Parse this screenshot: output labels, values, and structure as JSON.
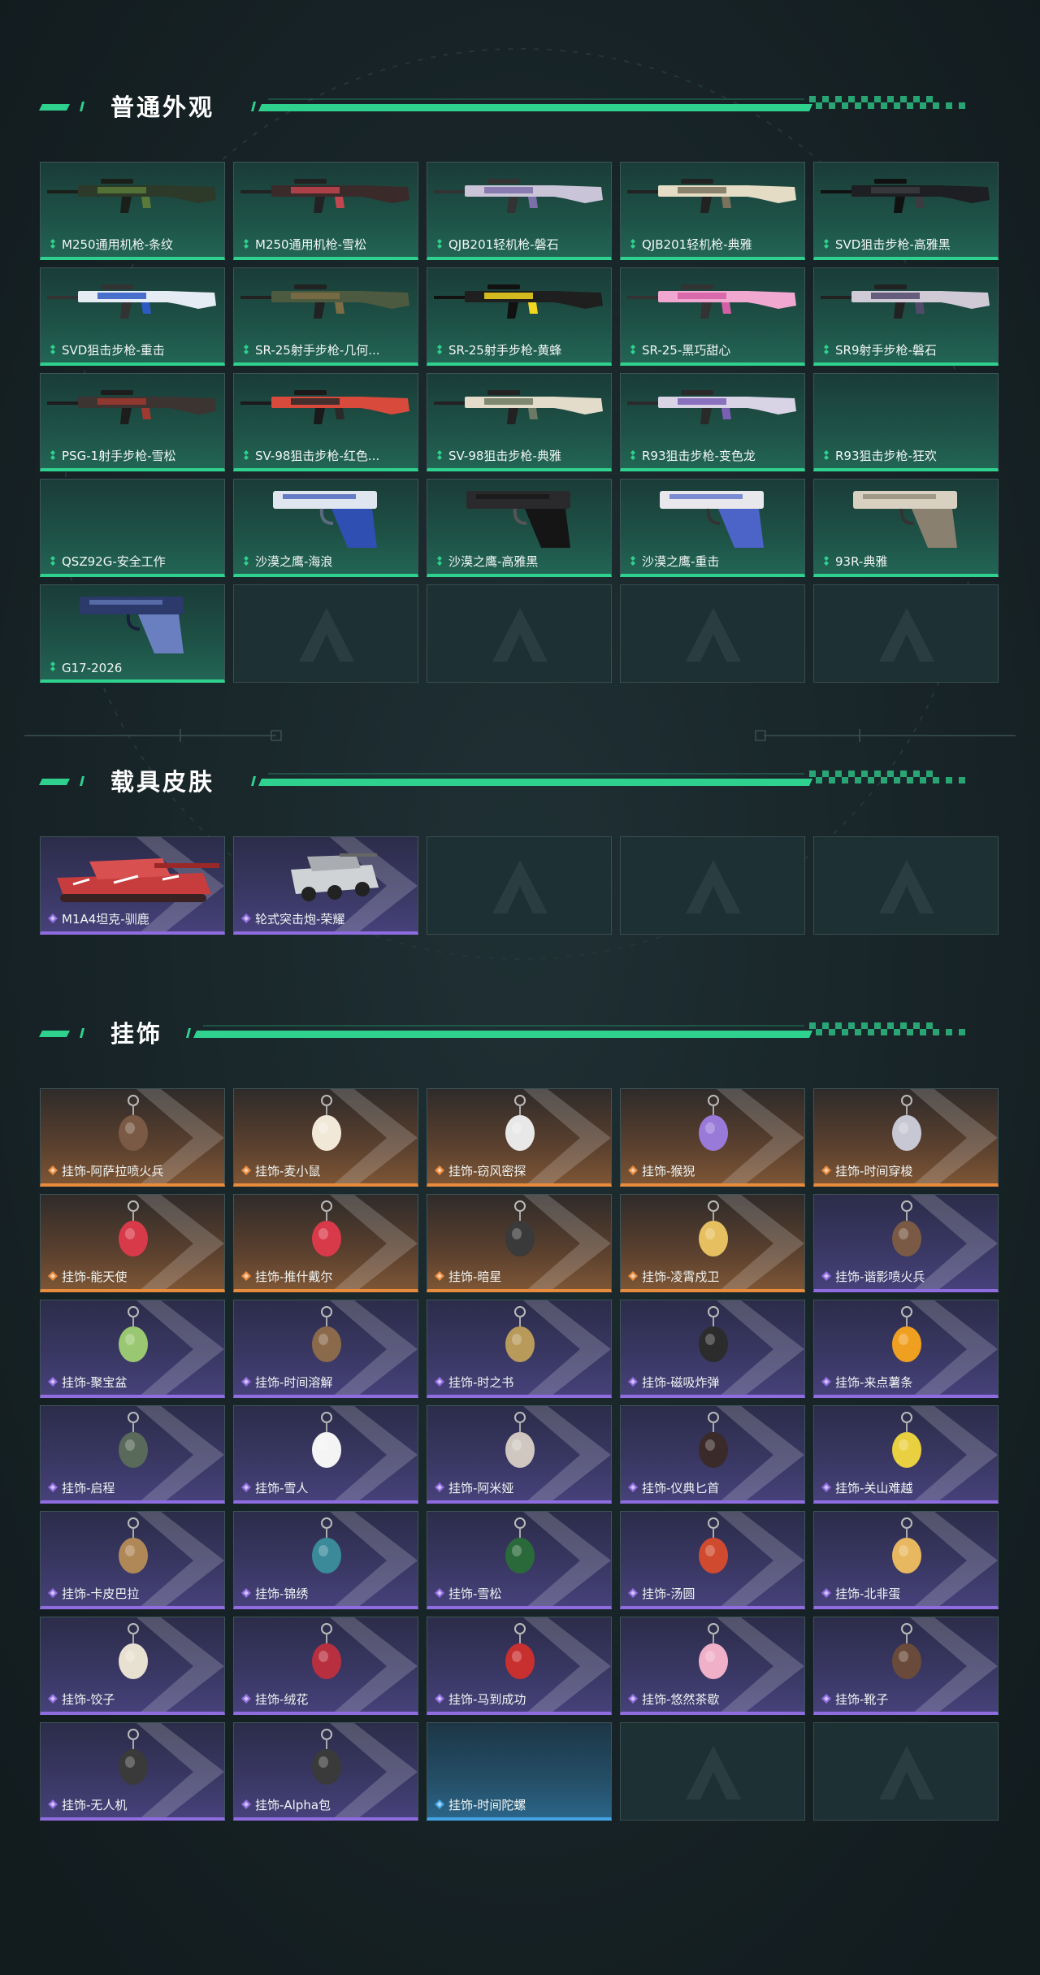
{
  "colors": {
    "green": "#2fd18e",
    "purple": "#8f6ce0",
    "orange": "#e98b3c",
    "blue": "#43a4e6"
  },
  "sections": {
    "weapons": {
      "title": "普通外观",
      "items": [
        {
          "label": "M250通用机枪-条纹",
          "rarity": "green",
          "art": "lmg"
        },
        {
          "label": "M250通用机枪-雪松",
          "rarity": "green",
          "art": "lmg-red"
        },
        {
          "label": "QJB201轻机枪-磐石",
          "rarity": "green",
          "art": "lmg-marble"
        },
        {
          "label": "QJB201轻机枪-典雅",
          "rarity": "green",
          "art": "lmg-cream"
        },
        {
          "label": "SVD狙击步枪-高雅黑",
          "rarity": "green",
          "art": "sniper-dark"
        },
        {
          "label": "SVD狙击步枪-重击",
          "rarity": "green",
          "art": "sniper-blue"
        },
        {
          "label": "SR-25射手步枪-几何...",
          "rarity": "green",
          "art": "rifle-camo"
        },
        {
          "label": "SR-25射手步枪-黄蜂",
          "rarity": "green",
          "art": "rifle-yellow"
        },
        {
          "label": "SR-25-黑巧甜心",
          "rarity": "green",
          "art": "rifle-pink"
        },
        {
          "label": "SR9射手步枪-磐石",
          "rarity": "green",
          "art": "rifle-marble"
        },
        {
          "label": "PSG-1射手步枪-雪松",
          "rarity": "green",
          "art": "psg"
        },
        {
          "label": "SV-98狙击步枪-红色...",
          "rarity": "green",
          "art": "sv98-red"
        },
        {
          "label": "SV-98狙击步枪-典雅",
          "rarity": "green",
          "art": "sv98-cream"
        },
        {
          "label": "R93狙击步枪-变色龙",
          "rarity": "green",
          "art": "r93"
        },
        {
          "label": "R93狙击步枪-狂欢",
          "rarity": "green",
          "art": "none"
        },
        {
          "label": "QSZ92G-安全工作",
          "rarity": "green",
          "art": "none"
        },
        {
          "label": "沙漠之鹰-海浪",
          "rarity": "green",
          "art": "pistol-blue"
        },
        {
          "label": "沙漠之鹰-高雅黑",
          "rarity": "green",
          "art": "pistol-black"
        },
        {
          "label": "沙漠之鹰-重击",
          "rarity": "green",
          "art": "pistol-white"
        },
        {
          "label": "93R-典雅",
          "rarity": "green",
          "art": "pistol-cream"
        },
        {
          "label": "G17-2026",
          "rarity": "green",
          "art": "pistol-navy"
        },
        {
          "label": "",
          "rarity": "empty"
        },
        {
          "label": "",
          "rarity": "empty"
        },
        {
          "label": "",
          "rarity": "empty"
        },
        {
          "label": "",
          "rarity": "empty"
        }
      ]
    },
    "vehicles": {
      "title": "载具皮肤",
      "items": [
        {
          "label": "M1A4坦克-驯鹿",
          "rarity": "purple",
          "art": "tank"
        },
        {
          "label": "轮式突击炮-荣耀",
          "rarity": "purple",
          "art": "car"
        },
        {
          "label": "",
          "rarity": "empty"
        },
        {
          "label": "",
          "rarity": "empty"
        },
        {
          "label": "",
          "rarity": "empty"
        }
      ]
    },
    "charms": {
      "title": "挂饰",
      "items": [
        {
          "label": "挂饰-阿萨拉喷火兵",
          "rarity": "orange",
          "art": "charm-figure"
        },
        {
          "label": "挂饰-麦小鼠",
          "rarity": "orange",
          "art": "charm-mouse"
        },
        {
          "label": "挂饰-窃风密探",
          "rarity": "orange",
          "art": "charm-spy"
        },
        {
          "label": "挂饰-猴猊",
          "rarity": "orange",
          "art": "charm-purple"
        },
        {
          "label": "挂饰-时间穿梭",
          "rarity": "orange",
          "art": "charm-ring"
        },
        {
          "label": "挂饰-能天使",
          "rarity": "orange",
          "art": "charm-tag"
        },
        {
          "label": "挂饰-推什戴尔",
          "rarity": "orange",
          "art": "charm-tag"
        },
        {
          "label": "挂饰-暗星",
          "rarity": "orange",
          "art": "charm-bird"
        },
        {
          "label": "挂饰-凌霄戍卫",
          "rarity": "orange",
          "art": "charm-eagle"
        },
        {
          "label": "挂饰-谐影喷火兵",
          "rarity": "purple",
          "art": "charm-figure"
        },
        {
          "label": "挂饰-聚宝盆",
          "rarity": "purple",
          "art": "charm-pot"
        },
        {
          "label": "挂饰-时间溶解",
          "rarity": "purple",
          "art": "charm-small"
        },
        {
          "label": "挂饰-时之书",
          "rarity": "purple",
          "art": "charm-book"
        },
        {
          "label": "挂饰-磁吸炸弹",
          "rarity": "purple",
          "art": "charm-bomb"
        },
        {
          "label": "挂饰-来点薯条",
          "rarity": "purple",
          "art": "charm-fries"
        },
        {
          "label": "挂饰-启程",
          "rarity": "purple",
          "art": "charm-disc"
        },
        {
          "label": "挂饰-雪人",
          "rarity": "purple",
          "art": "charm-snowman"
        },
        {
          "label": "挂饰-阿米娅",
          "rarity": "purple",
          "art": "charm-bunny"
        },
        {
          "label": "挂饰-仪典匕首",
          "rarity": "purple",
          "art": "charm-dagger"
        },
        {
          "label": "挂饰-关山难越",
          "rarity": "purple",
          "art": "charm-yellow"
        },
        {
          "label": "挂饰-卡皮巴拉",
          "rarity": "purple",
          "art": "charm-capy"
        },
        {
          "label": "挂饰-锦绣",
          "rarity": "purple",
          "art": "charm-butterfly"
        },
        {
          "label": "挂饰-雪松",
          "rarity": "purple",
          "art": "charm-tree"
        },
        {
          "label": "挂饰-汤圆",
          "rarity": "purple",
          "art": "charm-bowl"
        },
        {
          "label": "挂饰-北非蛋",
          "rarity": "purple",
          "art": "charm-pan"
        },
        {
          "label": "挂饰-饺子",
          "rarity": "purple",
          "art": "charm-plate"
        },
        {
          "label": "挂饰-绒花",
          "rarity": "purple",
          "art": "charm-flower"
        },
        {
          "label": "挂饰-马到成功",
          "rarity": "purple",
          "art": "charm-horse"
        },
        {
          "label": "挂饰-悠然茶歇",
          "rarity": "purple",
          "art": "charm-cake"
        },
        {
          "label": "挂饰-靴子",
          "rarity": "purple",
          "art": "charm-boot"
        },
        {
          "label": "挂饰-无人机",
          "rarity": "purple",
          "art": "charm-drone"
        },
        {
          "label": "挂饰-Alpha包",
          "rarity": "purple",
          "art": "charm-bag"
        },
        {
          "label": "挂饰-时间陀螺",
          "rarity": "blue",
          "art": "none"
        },
        {
          "label": "",
          "rarity": "empty"
        },
        {
          "label": "",
          "rarity": "empty"
        }
      ]
    }
  }
}
